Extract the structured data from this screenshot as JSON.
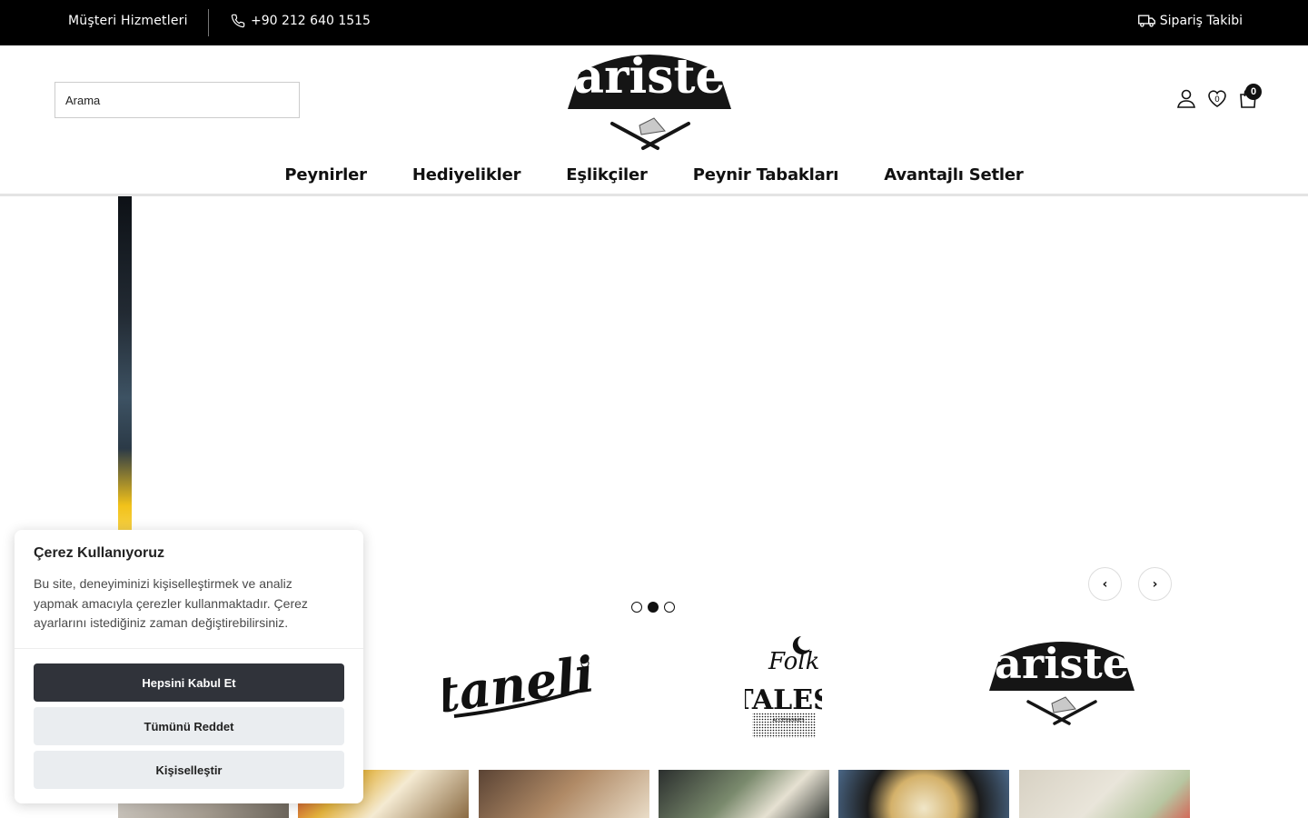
{
  "topbar": {
    "customer_service": "Müşteri Hizmetleri",
    "phone": "+90 212 640 1515",
    "order_tracking": "Sipariş Takibi"
  },
  "header": {
    "search_placeholder": "Arama",
    "logo_text": "ariste",
    "cart_count": "0",
    "icons": [
      "user-icon",
      "heart-icon",
      "shopping-bag-icon"
    ]
  },
  "nav": {
    "items": [
      {
        "label": "Peynirler"
      },
      {
        "label": "Hediyelikler"
      },
      {
        "label": "Eşlikçiler"
      },
      {
        "label": "Peynir Tabakları"
      },
      {
        "label": "Avantajlı Setler"
      }
    ]
  },
  "slider": {
    "prev_arrow": "‹",
    "next_arrow": "›",
    "dot_count": 3,
    "active_dot": 2
  },
  "brands": {
    "taneli": "taneli",
    "folk_tales_top": "Folk",
    "folk_tales_bottom": "TALES",
    "folk_tales_sub": "ACCESSORIES",
    "ariste": "ariste"
  },
  "cookie": {
    "title": "Çerez Kullanıyoruz",
    "body": "Bu site, deneyiminizi kişiselleştirmek ve analiz yapmak amacıyla çerezler kullanmaktadır. Çerez ayarlarını istediğiniz zaman değiştirebilirsiniz.",
    "accept_all": "Hepsini Kabul Et",
    "reject_all": "Tümünü Reddet",
    "customize": "Kişiselleştir"
  },
  "colors": {
    "topbar_bg": "#000000",
    "cookie_primary": "#30333a",
    "cookie_secondary": "#eaedf0"
  }
}
